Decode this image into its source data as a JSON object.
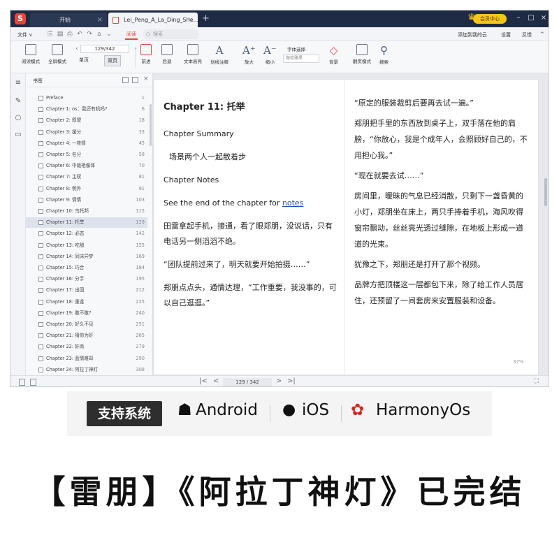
{
  "titlebar": {
    "logo": "S",
    "tab_home": "开始",
    "tab_doc": "Lei_Peng_A_La_Ding_She...",
    "tab_add": "+",
    "vip": "会员中心",
    "win_min": "–",
    "win_max": "□",
    "win_close": "×"
  },
  "menubar": {
    "file": "文件 ∨",
    "read": "阅读",
    "search_placeholder": "搜索",
    "right_items": [
      "添加到我的云",
      "设置",
      "反馈"
    ]
  },
  "toolbar": {
    "read_mode": "阅读模式",
    "fullscreen": "全屏模式",
    "page_value": "129/342",
    "single_page": "单页",
    "double_page": "双页",
    "prev": "前进",
    "next": "后退",
    "highlight": "文本高亮",
    "annotate": "划线注释",
    "zoom_in": "放大",
    "zoom_out": "缩小",
    "font_label": "字体选择",
    "font_value": "微软雅黑",
    "background": "背景",
    "page_turn": "翻页模式",
    "search": "搜索"
  },
  "bookmarks": {
    "title": "书签",
    "items": [
      {
        "label": "Preface",
        "page": "1"
      },
      {
        "label": "Chapter 1: os：我还有机吗?",
        "page": "6"
      },
      {
        "label": "Chapter 2: 叙盟",
        "page": "18"
      },
      {
        "label": "Chapter 3: 援分",
        "page": "33"
      },
      {
        "label": "Chapter 4: 一夜情",
        "page": "45"
      },
      {
        "label": "Chapter 5: 名分",
        "page": "58"
      },
      {
        "label": "Chapter 6: 中裁艳像体",
        "page": "70"
      },
      {
        "label": "Chapter 7: 主权",
        "page": "81"
      },
      {
        "label": "Chapter 8: 例外",
        "page": "91"
      },
      {
        "label": "Chapter 9: 情情",
        "page": "103"
      },
      {
        "label": "Chapter 10: 乌托邦",
        "page": "115"
      },
      {
        "label": "Chapter 11: 托举",
        "page": "129"
      },
      {
        "label": "Chapter 12: 必态",
        "page": "142"
      },
      {
        "label": "Chapter 13: 吃醋",
        "page": "155"
      },
      {
        "label": "Chapter 14: 同床异梦",
        "page": "169"
      },
      {
        "label": "Chapter 15: 巧合",
        "page": "184"
      },
      {
        "label": "Chapter 16: 分手",
        "page": "195"
      },
      {
        "label": "Chapter 17: 出国",
        "page": "212"
      },
      {
        "label": "Chapter 18: 重逢",
        "page": "225"
      },
      {
        "label": "Chapter 19: 敢不敢?",
        "page": "240"
      },
      {
        "label": "Chapter 20: 好久不见",
        "page": "251"
      },
      {
        "label": "Chapter 21: 猜你为奸",
        "page": "265"
      },
      {
        "label": "Chapter 22: 奸商",
        "page": "279"
      },
      {
        "label": "Chapter 23: 蓝情难却",
        "page": "290"
      },
      {
        "label": "Chapter 24: 阿拉丁神灯",
        "page": "308"
      }
    ]
  },
  "document": {
    "chapter_title": "Chapter 11: 托举",
    "summary_heading": "Chapter Summary",
    "summary_text": "场景两个人一起散着步",
    "notes_heading": "Chapter Notes",
    "notes_text": "See the end of the chapter for",
    "notes_link": "notes",
    "left_para_1": "田雷拿起手机，接通，看了眼郑朋，没说话，只有电话另一侧滔滔不绝。",
    "left_para_2": "“团队提前过来了，明天就要开始拍摄……”",
    "left_para_3": "郑朋点点头，通情达理，“工作重要，我没事的，可以自己逛逛。”",
    "right_para_1": "“原定的服装裁剪后要再去试一遍。”",
    "right_para_2": "郑朋把手里的东西放到桌子上，双手落在他的肩膀，“你放心，我是个成年人，会照顾好自己的，不用担心我。”",
    "right_para_3": "“现在就要去试……”",
    "right_para_4": "房间里，暧昧的气息已经消散，只剩下一盏昏黄的小灯，郑朋坐在床上，两只手捧着手机，海风吹得窗帘飘动，丝丝亮光透过缝隙，在地板上形成一道道的光束。",
    "right_para_5": "犹豫之下，郑朋还是打开了那个视频。",
    "right_para_6": "品牌方把顶楼这一层都包下来，除了给工作人员居住，还预留了一间套房来安置服装和设备。",
    "zoom": "37%"
  },
  "statusbar": {
    "first": "|<",
    "prev": "<",
    "page": "129 / 342",
    "next": ">",
    "last": ">|"
  },
  "banner": {
    "badge": "支持系统",
    "android": "Android",
    "ios": "iOS",
    "harmony": "HarmonyOs"
  },
  "headline": "【雷朋】《阿拉丁神灯》已完结",
  "colors": {
    "accent": "#e8443a",
    "titlebar": "#1f2b44",
    "vip": "#f5c518",
    "link": "#1a56c2",
    "harmony_red": "#d9251c"
  }
}
